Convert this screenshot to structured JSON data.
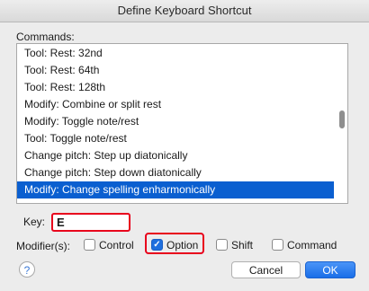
{
  "window": {
    "title": "Define Keyboard Shortcut"
  },
  "commands": {
    "label": "Commands:",
    "items": [
      "Tool: Rest: 32nd",
      "Tool: Rest: 64th",
      "Tool: Rest: 128th",
      "Modify: Combine or split rest",
      "Modify: Toggle note/rest",
      "Tool: Toggle note/rest",
      "Change pitch: Step up diatonically",
      "Change pitch: Step down diatonically",
      "Modify: Change spelling enharmonically"
    ],
    "selected_index": 8
  },
  "key": {
    "label": "Key:",
    "value": "E"
  },
  "modifiers": {
    "label": "Modifier(s):",
    "control": {
      "label": "Control",
      "checked": false
    },
    "option": {
      "label": "Option",
      "checked": true
    },
    "shift": {
      "label": "Shift",
      "checked": false
    },
    "command": {
      "label": "Command",
      "checked": false
    }
  },
  "buttons": {
    "help": "?",
    "cancel": "Cancel",
    "ok": "OK"
  },
  "colors": {
    "selection": "#0a5fd0",
    "highlight": "#e8001c",
    "accent": "#1f6fde"
  }
}
